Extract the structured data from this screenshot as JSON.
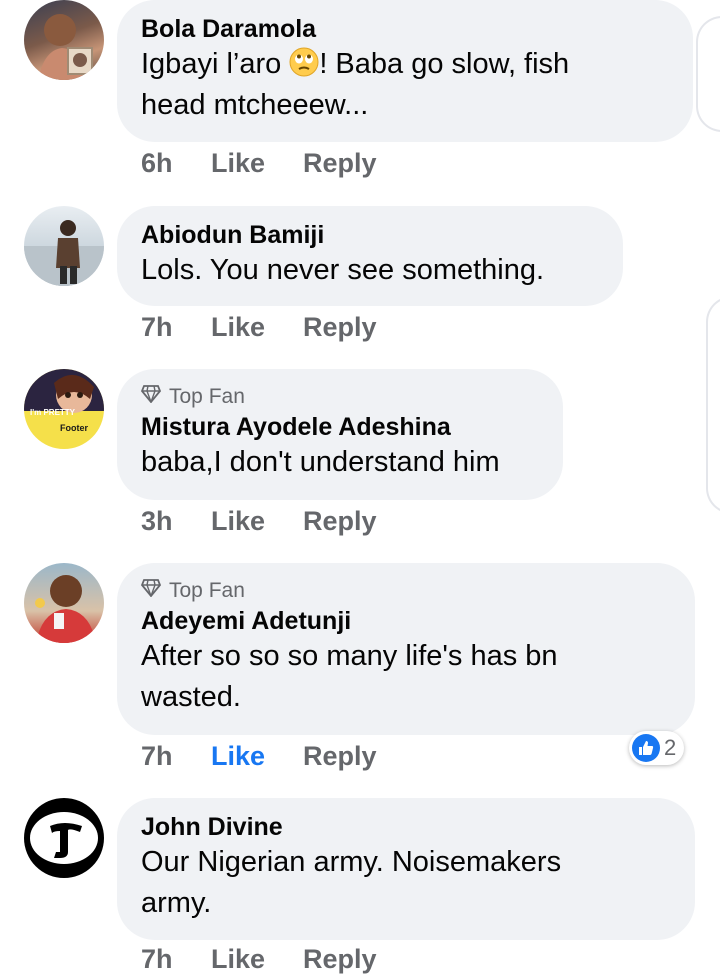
{
  "comments": [
    {
      "name": "Bola Daramola",
      "text_a": "Igbayi l’aro ",
      "text_b": "! Baba go slow, fish",
      "text_c": "head mtcheeew...",
      "time": "6h",
      "like": "Like",
      "reply": "Reply",
      "emoji": "rolling-eyes-emoji"
    },
    {
      "name": "Abiodun Bamiji",
      "text": "Lols.  You never see something.",
      "time": "7h",
      "like": "Like",
      "reply": "Reply"
    },
    {
      "badge": "Top Fan",
      "name": "Mistura Ayodele Adeshina",
      "text": "baba,I don't understand him",
      "time": "3h",
      "like": "Like",
      "reply": "Reply",
      "avatar_text_1": "I'm PRETTY",
      "avatar_text_2": "Footer"
    },
    {
      "badge": "Top Fan",
      "name": "Adeyemi Adetunji",
      "text_a": "After so so so many life's has bn",
      "text_b": "wasted.",
      "time": "7h",
      "like": "Like",
      "reply": "Reply",
      "reaction_count": "2",
      "liked": true
    },
    {
      "name": "John Divine",
      "text_a": "Our Nigerian army. Noisemakers",
      "text_b": "army.",
      "time": "7h",
      "like": "Like",
      "reply": "Reply"
    }
  ],
  "colors": {
    "bubble": "#f0f2f5",
    "like_active": "#1877f2",
    "secondary_text": "#65676b"
  }
}
